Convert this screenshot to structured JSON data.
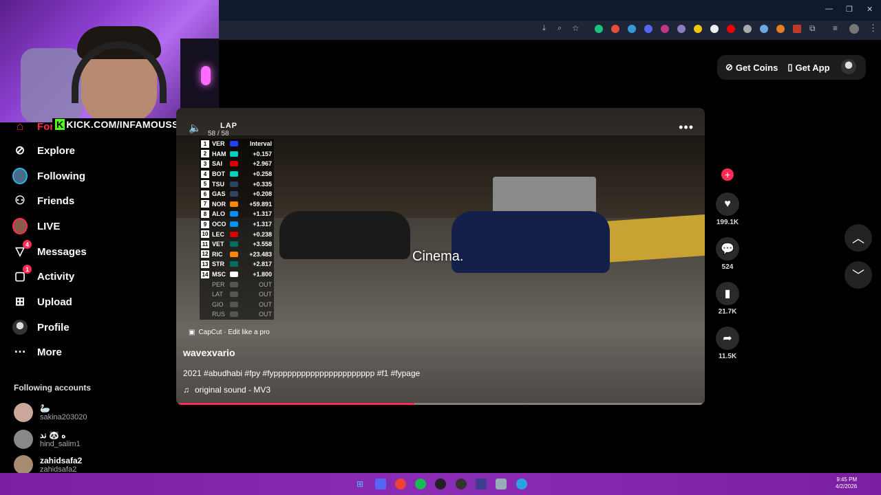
{
  "browser": {
    "window_controls": [
      "—",
      "❐",
      "✕"
    ]
  },
  "overlay": {
    "kick_prefix": "K",
    "kick_text": "KICK.COM/INFAMOUSS"
  },
  "header": {
    "get_coins": "Get Coins",
    "get_app": "Get App"
  },
  "sidebar": {
    "items": [
      {
        "label": "For",
        "icon": "home-icon"
      },
      {
        "label": "Explore",
        "icon": "compass-icon"
      },
      {
        "label": "Following",
        "icon": "following-avatar"
      },
      {
        "label": "Friends",
        "icon": "friends-icon"
      },
      {
        "label": "LIVE",
        "icon": "live-avatar"
      },
      {
        "label": "Messages",
        "icon": "paper-plane-icon",
        "badge": "4"
      },
      {
        "label": "Activity",
        "icon": "activity-icon",
        "badge": "1"
      },
      {
        "label": "Upload",
        "icon": "plus-square-icon"
      },
      {
        "label": "Profile",
        "icon": "profile-avatar"
      },
      {
        "label": "More",
        "icon": "ellipsis-icon"
      }
    ],
    "following_header": "Following accounts",
    "accounts": [
      {
        "name": "🦢",
        "handle": "sakina203020"
      },
      {
        "name": "ه 🐼 ند",
        "handle": "hind_salim1"
      },
      {
        "name": "zahidsafa2",
        "handle": "zahidsafa2"
      }
    ]
  },
  "video": {
    "lap_label": "LAP",
    "lap_count": "58 / 58",
    "leaderboard": [
      {
        "pos": "1",
        "driver": "VER",
        "gap": "Interval",
        "color": "#1e41ff"
      },
      {
        "pos": "2",
        "driver": "HAM",
        "gap": "+0.157",
        "color": "#00d2be"
      },
      {
        "pos": "3",
        "driver": "SAI",
        "gap": "+2.967",
        "color": "#dc0000"
      },
      {
        "pos": "4",
        "driver": "BOT",
        "gap": "+0.258",
        "color": "#00d2be"
      },
      {
        "pos": "5",
        "driver": "TSU",
        "gap": "+0.335",
        "color": "#2b4562"
      },
      {
        "pos": "6",
        "driver": "GAS",
        "gap": "+0.208",
        "color": "#2b4562"
      },
      {
        "pos": "7",
        "driver": "NOR",
        "gap": "+59.891",
        "color": "#ff8700"
      },
      {
        "pos": "8",
        "driver": "ALO",
        "gap": "+1.317",
        "color": "#0090ff"
      },
      {
        "pos": "9",
        "driver": "OCO",
        "gap": "+1.317",
        "color": "#0090ff"
      },
      {
        "pos": "10",
        "driver": "LEC",
        "gap": "+0.238",
        "color": "#dc0000"
      },
      {
        "pos": "11",
        "driver": "VET",
        "gap": "+3.558",
        "color": "#006f62"
      },
      {
        "pos": "12",
        "driver": "RIC",
        "gap": "+23.483",
        "color": "#ff8700"
      },
      {
        "pos": "13",
        "driver": "STR",
        "gap": "+2.817",
        "color": "#006f62"
      },
      {
        "pos": "14",
        "driver": "MSC",
        "gap": "+1.800",
        "color": "#ffffff"
      }
    ],
    "retired": [
      {
        "driver": "PER",
        "gap": "OUT"
      },
      {
        "driver": "LAT",
        "gap": "OUT"
      },
      {
        "driver": "GIO",
        "gap": "OUT"
      },
      {
        "driver": "RUS",
        "gap": "OUT"
      }
    ],
    "caption": "Cinema.",
    "capcut": "CapCut · Edit like a pro",
    "author": "wavexvario",
    "description": "2021 #abudhabi #fpy #fypppppppppppppppppppppp #f1 #fypage",
    "sound": "original sound - MV3",
    "progress": 0.45
  },
  "actions": {
    "likes": "199.1K",
    "comments": "524",
    "saves": "21.7K",
    "shares": "11.5K"
  },
  "taskbar": {
    "time": "9:45 PM",
    "date": "4/2/2026"
  },
  "colors": {
    "accent": "#fe2c55",
    "kick": "#53fc18"
  }
}
